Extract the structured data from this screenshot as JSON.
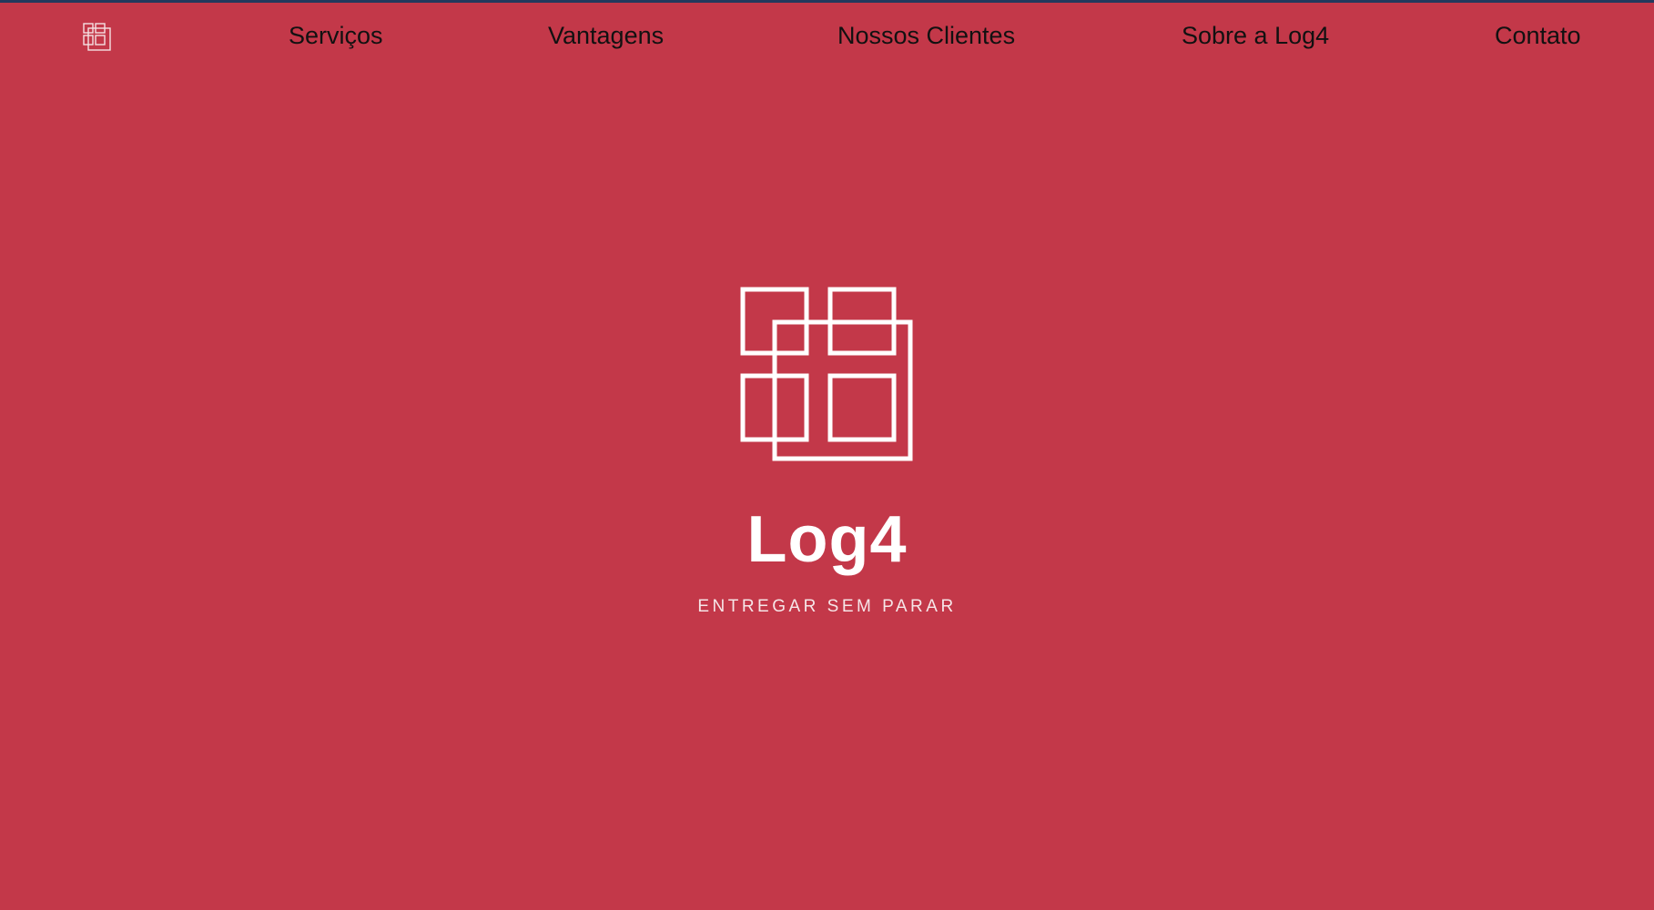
{
  "header": {
    "nav": [
      {
        "label": "Serviços"
      },
      {
        "label": "Vantagens"
      },
      {
        "label": "Nossos Clientes"
      },
      {
        "label": "Sobre a Log4"
      },
      {
        "label": "Contato"
      }
    ]
  },
  "hero": {
    "brand": "Log4",
    "tagline": "ENTREGAR SEM PARAR"
  },
  "colors": {
    "background": "#c33849",
    "top_strip": "#23395d",
    "nav_text": "#111111",
    "logo": "#ffffff"
  },
  "icons": {
    "nav_logo": "log4-logo-icon",
    "hero_logo": "log4-logo-mark-icon"
  }
}
